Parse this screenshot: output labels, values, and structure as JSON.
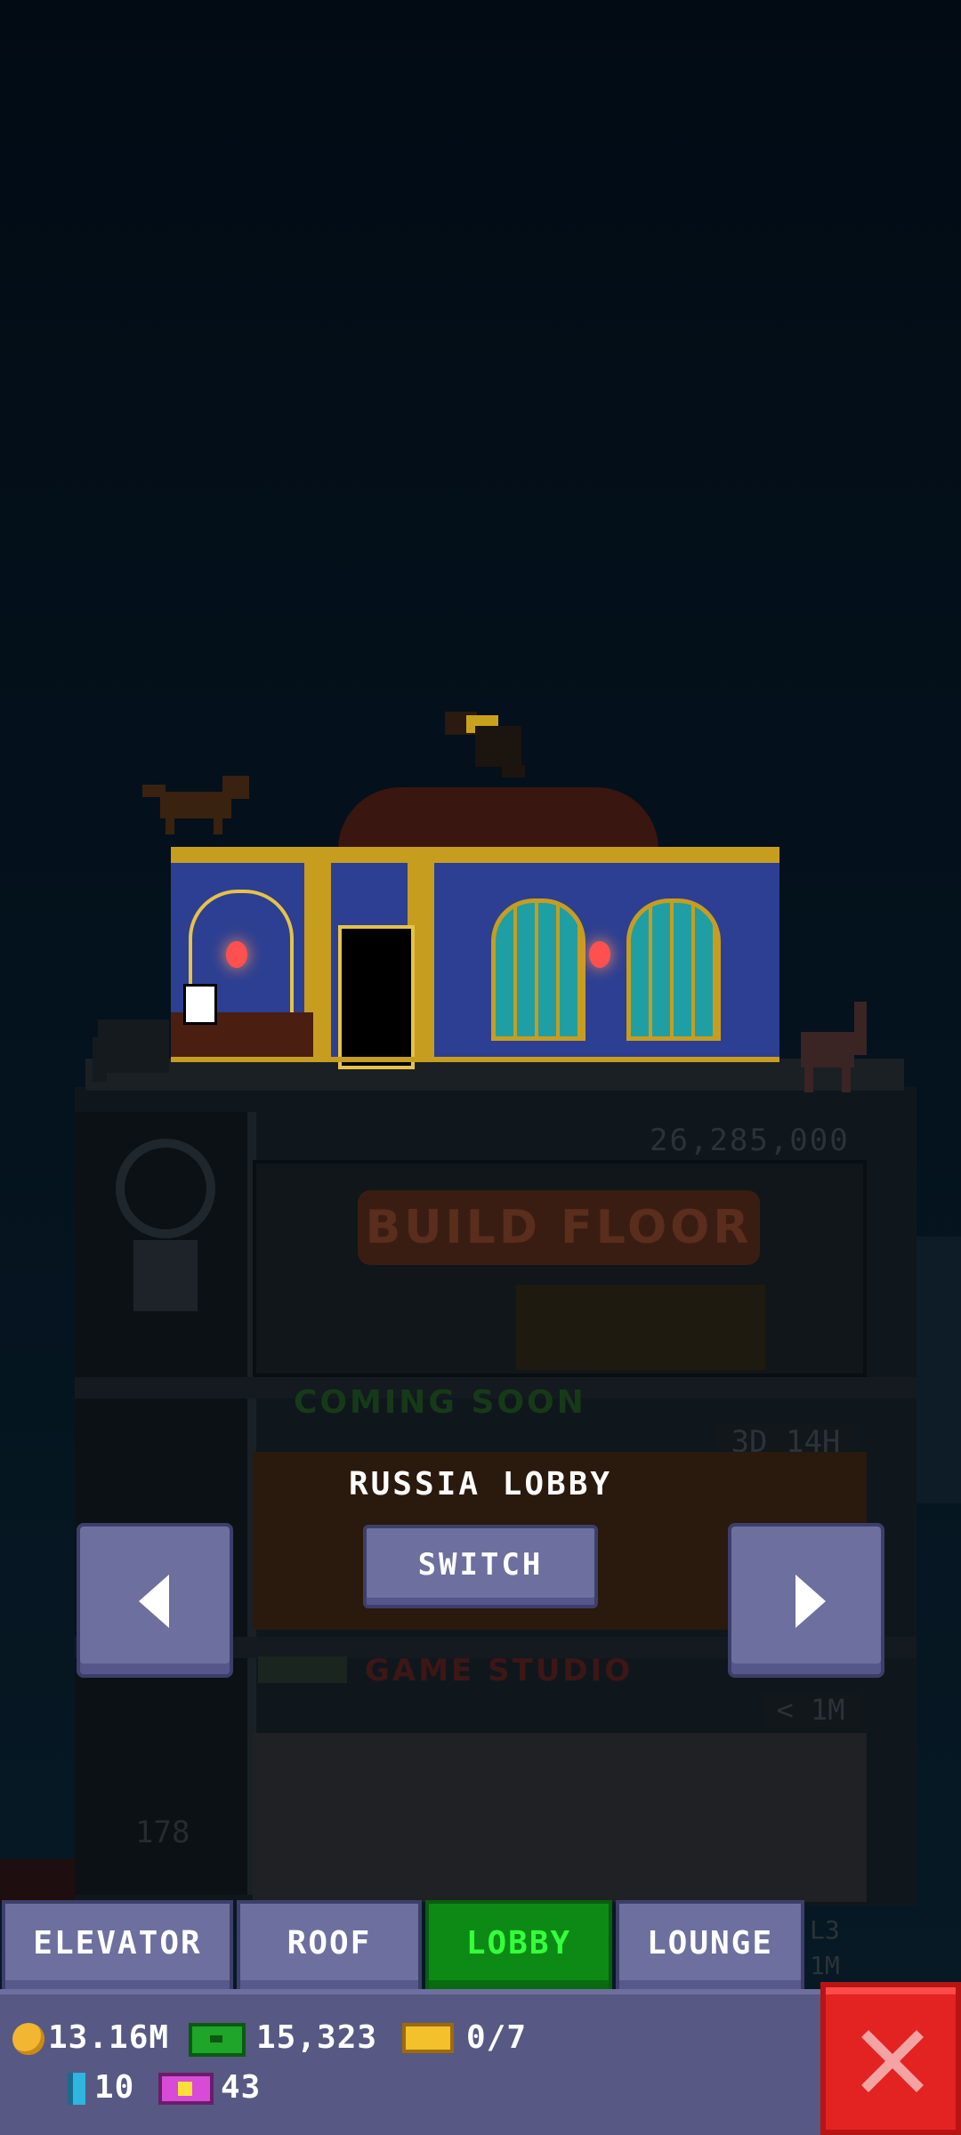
{
  "scene": {
    "top_floor_cost": "26,285,000",
    "build_floor_label": "BUILD FLOOR",
    "coming_soon_label": "COMING SOON",
    "coming_soon_timer": "3D 14H",
    "studio_label": "GAME STUDIO",
    "studio_timer": "< 1M",
    "floor_number": "178"
  },
  "switcher": {
    "floor_name": "RUSSIA LOBBY",
    "switch_label": "SWITCH",
    "prev_icon": "arrow-left-icon",
    "next_icon": "arrow-right-icon"
  },
  "tabs": [
    {
      "label": "ELEVATOR",
      "active": false
    },
    {
      "label": "ROOF",
      "active": false
    },
    {
      "label": "LOBBY",
      "active": true
    },
    {
      "label": "LOUNGE",
      "active": false
    }
  ],
  "tab_side": {
    "line1": "L3",
    "line2": "1M"
  },
  "resources": {
    "coins": "13.16M",
    "bux": "15,323",
    "tickets": "0/7",
    "gems": "10",
    "vip": "43"
  },
  "colors": {
    "active_tab": "#0d8a16",
    "button": "#6d6f9f",
    "close": "#e32222",
    "background": "#030c16"
  }
}
